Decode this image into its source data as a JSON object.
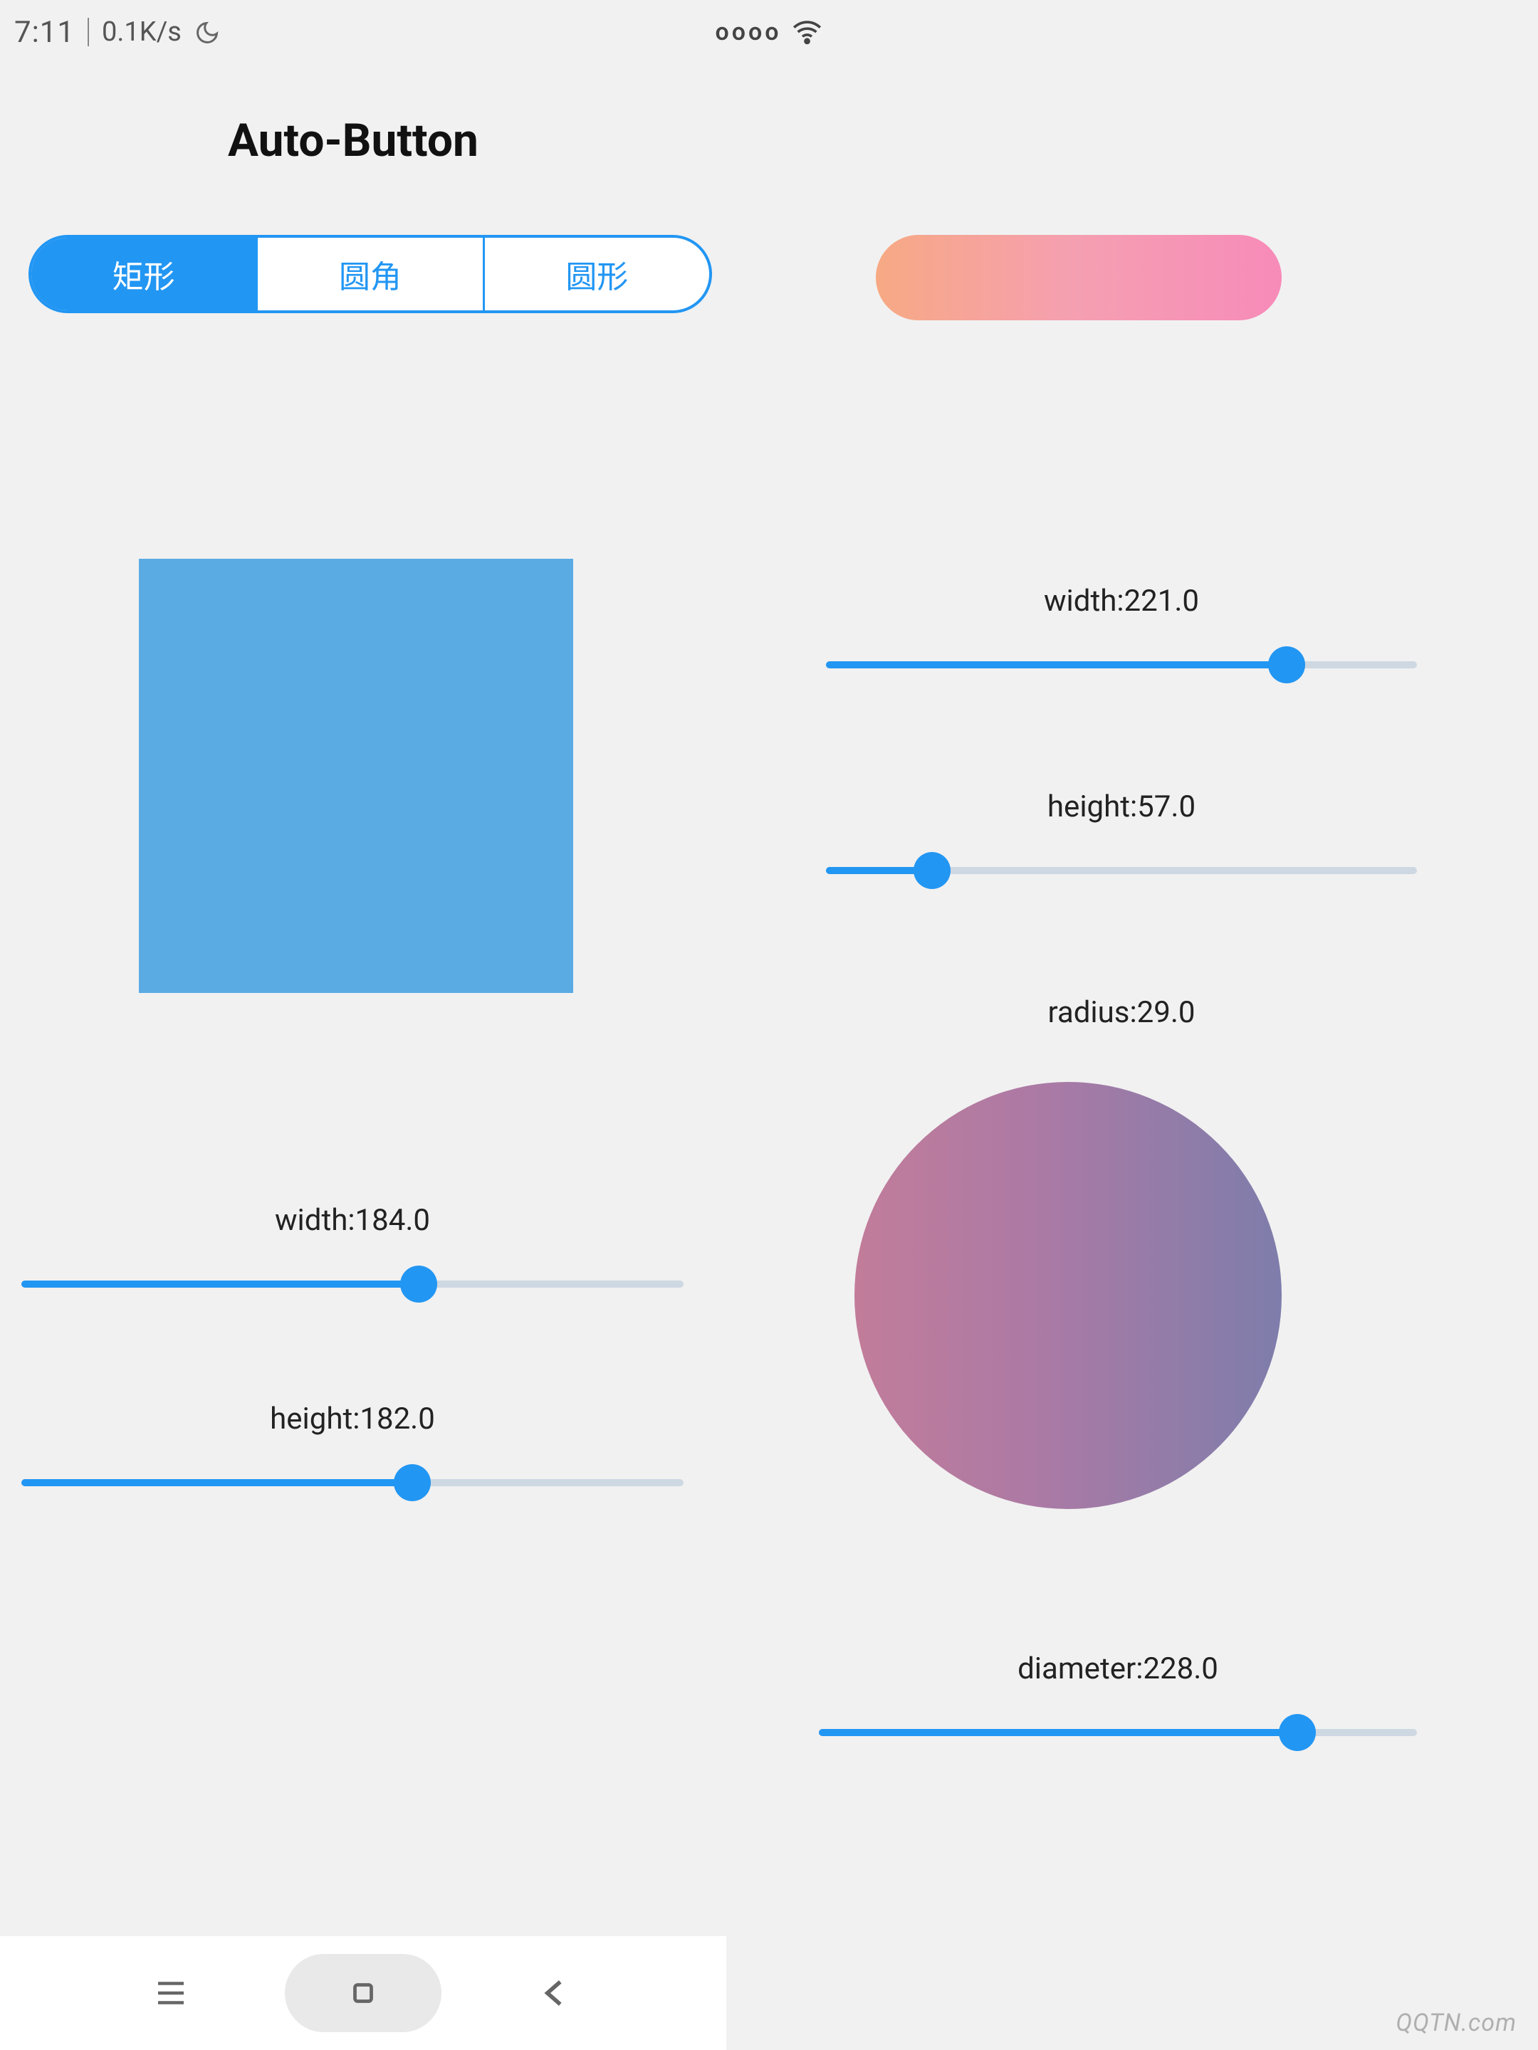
{
  "status": {
    "time": "7:11",
    "speed": "0.1K/s",
    "signal": "oooo"
  },
  "title": "Auto-Button",
  "tabs": {
    "rect": "矩形",
    "rounded": "圆角",
    "circle": "圆形",
    "active_index": 0
  },
  "pill": {
    "width": {
      "label": "width:221.0",
      "value": 221.0,
      "percent": 78
    },
    "height": {
      "label": "height:57.0",
      "value": 57.0,
      "percent": 18
    },
    "radius": {
      "label": "radius:29.0",
      "value": 29.0
    },
    "gradient": [
      "#f7a984",
      "#f78bb9"
    ]
  },
  "square": {
    "width": {
      "label": "width:184.0",
      "value": 184.0,
      "percent": 60
    },
    "height": {
      "label": "height:182.0",
      "value": 182.0,
      "percent": 59
    },
    "color": "#5aabe4"
  },
  "circle": {
    "diameter": {
      "label": "diameter:228.0",
      "value": 228.0,
      "percent": 80
    },
    "gradient": [
      "#c27c9a",
      "#7e7dab"
    ]
  },
  "watermark": "QQTN.com"
}
